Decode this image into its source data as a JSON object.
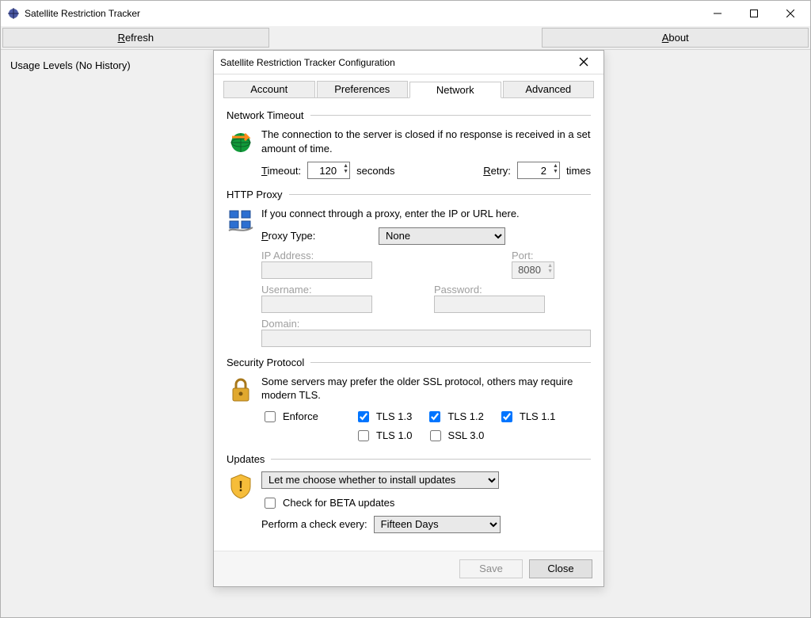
{
  "app": {
    "title": "Satellite Restriction Tracker"
  },
  "toolbar": {
    "refresh": "Refresh",
    "about": "About"
  },
  "main": {
    "usage_levels": "Usage Levels (No History)"
  },
  "dialog": {
    "title": "Satellite Restriction Tracker Configuration",
    "tabs": {
      "account": "Account",
      "preferences": "Preferences",
      "network": "Network",
      "advanced": "Advanced"
    },
    "network": {
      "timeout_group": "Network Timeout",
      "timeout_desc": "The connection to the server is closed if no response is received in a set amount of time.",
      "timeout_label": "Timeout:",
      "timeout_value": "120",
      "seconds": "seconds",
      "retry_label": "Retry:",
      "retry_value": "2",
      "times": "times",
      "proxy_group": "HTTP Proxy",
      "proxy_desc": "If you connect through a proxy, enter the IP or URL here.",
      "proxy_type_label": "Proxy Type:",
      "proxy_type_value": "None",
      "ip_label": "IP Address:",
      "port_label": "Port:",
      "port_value": "8080",
      "user_label": "Username:",
      "pass_label": "Password:",
      "domain_label": "Domain:",
      "security_group": "Security Protocol",
      "security_desc": "Some servers may prefer the older SSL protocol, others may require modern TLS.",
      "enforce": "Enforce",
      "tls13": "TLS 1.3",
      "tls12": "TLS 1.2",
      "tls11": "TLS 1.1",
      "tls10": "TLS 1.0",
      "ssl30": "SSL 3.0",
      "updates_group": "Updates",
      "updates_mode": "Let me choose whether to install updates",
      "beta": "Check for BETA updates",
      "check_every_label": "Perform a check every:",
      "check_every_value": "Fifteen Days"
    },
    "buttons": {
      "save": "Save",
      "close": "Close"
    }
  }
}
